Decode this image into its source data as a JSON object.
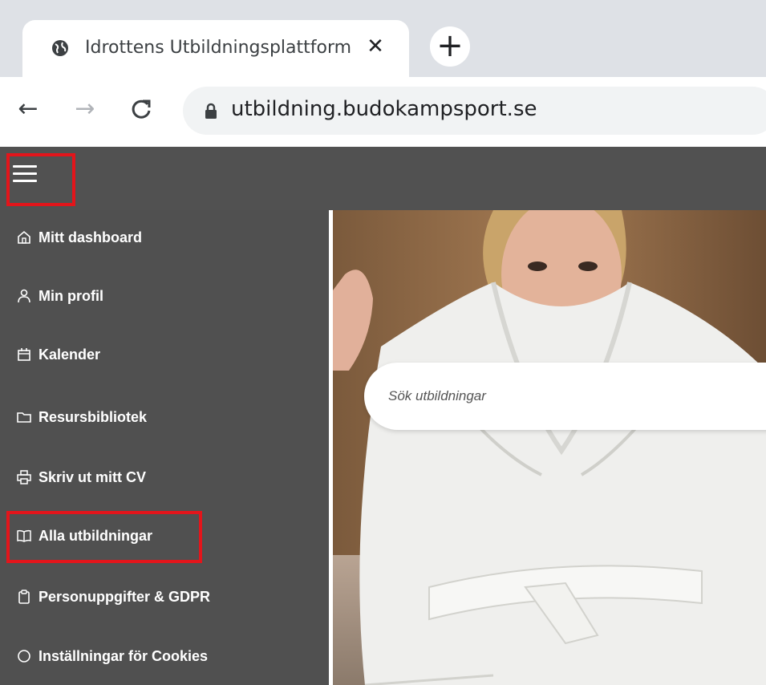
{
  "browser": {
    "tab_title": "Idrottens Utbildningsplattform",
    "close_glyph": "✕",
    "new_tab_glyph": "+",
    "url": "utbildning.budokampsport.se",
    "back_glyph": "←",
    "forward_glyph": "→",
    "reload_glyph": "C"
  },
  "sidebar": {
    "items": [
      {
        "label": "Mitt dashboard",
        "icon": "home-icon"
      },
      {
        "label": "Min profil",
        "icon": "user-icon"
      },
      {
        "label": "Kalender",
        "icon": "calendar-icon"
      },
      {
        "label": "Resursbibliotek",
        "icon": "folder-icon"
      },
      {
        "label": "Skriv ut mitt CV",
        "icon": "printer-icon"
      },
      {
        "label": "Alla utbildningar",
        "icon": "book-icon"
      },
      {
        "label": "Personuppgifter & GDPR",
        "icon": "clipboard-icon"
      },
      {
        "label": "Inställningar för Cookies",
        "icon": "circle-icon"
      }
    ]
  },
  "search": {
    "placeholder": "Sök utbildningar"
  },
  "colors": {
    "appbar": "#515151",
    "sidebar": "#505050",
    "highlight": "#e3151b"
  }
}
